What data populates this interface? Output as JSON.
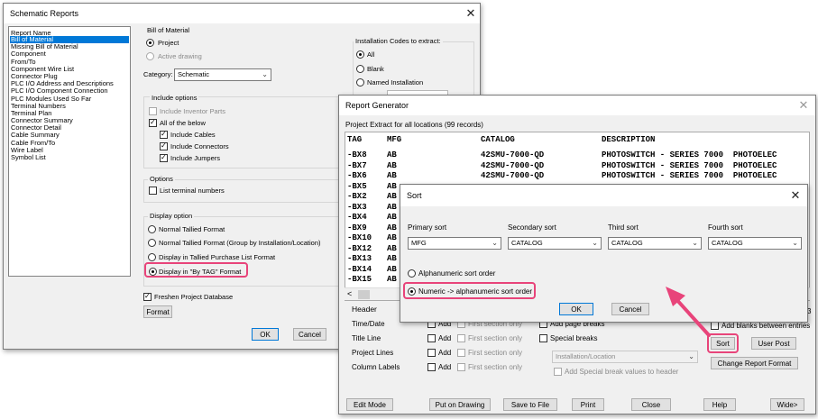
{
  "schematic": {
    "title": "Schematic Reports",
    "report_name_label": "Report Name",
    "reports": [
      "Bill of Material",
      "Missing Bill of Material",
      "Component",
      "From/To",
      "Component Wire List",
      "Connector Plug",
      "PLC I/O Address and Descriptions",
      "PLC I/O Component Connection",
      "PLC Modules Used So Far",
      "Terminal Numbers",
      "Terminal Plan",
      "Connector Summary",
      "Connector Detail",
      "Cable Summary",
      "Cable From/To",
      "Wire Label",
      "Symbol List"
    ],
    "bom_label": "Bill of Material",
    "project": "Project",
    "active_drawing": "Active drawing",
    "category_label": "Category:",
    "category_value": "Schematic",
    "include_options": "Include options",
    "include_inventor": "Include Inventor Parts",
    "all_below": "All of the below",
    "include_cables": "Include Cables",
    "include_connectors": "Include Connectors",
    "include_jumpers": "Include Jumpers",
    "options": "Options",
    "list_terminal": "List terminal numbers",
    "display_option": "Display option",
    "disp1": "Normal Tallied Format",
    "disp2": "Normal Tallied Format (Group by Installation/Location)",
    "disp3": "Display in Tallied Purchase List Format",
    "disp4": "Display in \"By TAG\" Format",
    "freshen": "Freshen Project Database",
    "format_btn": "Format",
    "ok": "OK",
    "cancel": "Cancel",
    "inst_label": "Installation Codes to extract:",
    "inst_all": "All",
    "inst_blank": "Blank",
    "inst_named": "Named Installation"
  },
  "generator": {
    "title": "Report Generator",
    "extract_label": "Project Extract for all locations (99 records)",
    "columns": [
      "TAG",
      "MFG",
      "CATALOG",
      "DESCRIPTION"
    ],
    "rows": [
      {
        "tag": "-BX8",
        "mfg": "AB",
        "catalog": "42SMU-7000-QD",
        "desc": "PHOTOSWITCH - SERIES 7000  PHOTOELEC"
      },
      {
        "tag": "-BX7",
        "mfg": "AB",
        "catalog": "42SMU-7000-QD",
        "desc": "PHOTOSWITCH - SERIES 7000  PHOTOELEC"
      },
      {
        "tag": "-BX6",
        "mfg": "AB",
        "catalog": "42SMU-7000-QD",
        "desc": "PHOTOSWITCH - SERIES 7000  PHOTOELEC"
      },
      {
        "tag": "-BX5",
        "mfg": "AB",
        "catalog": "",
        "desc": ""
      },
      {
        "tag": "-BX2",
        "mfg": "AB",
        "catalog": "",
        "desc": ""
      },
      {
        "tag": "-BX3",
        "mfg": "AB",
        "catalog": "",
        "desc": ""
      },
      {
        "tag": "-BX4",
        "mfg": "AB",
        "catalog": "",
        "desc": ""
      },
      {
        "tag": "-BX9",
        "mfg": "AB",
        "catalog": "",
        "desc": ""
      },
      {
        "tag": "-BX10",
        "mfg": "AB",
        "catalog": "",
        "desc": ""
      },
      {
        "tag": "-BX12",
        "mfg": "AB",
        "catalog": "",
        "desc": ""
      },
      {
        "tag": "-BX13",
        "mfg": "AB",
        "catalog": "",
        "desc": ""
      },
      {
        "tag": "-BX14",
        "mfg": "AB",
        "catalog": "",
        "desc": ""
      },
      {
        "tag": "-BX15",
        "mfg": "AB",
        "catalog": "",
        "desc": ""
      }
    ],
    "header_label": "Header",
    "time_date": "Time/Date",
    "title_line": "Title Line",
    "project_lines": "Project Lines",
    "column_labels": "Column Labels",
    "add": "Add",
    "first_section": "First section only",
    "add_page_breaks": "Add page breaks",
    "special_breaks": "Special breaks",
    "inst_loc": "Installation/Location",
    "add_special": "Add Special break values to header",
    "add_blanks": "Add blanks between entries",
    "page_num": "3",
    "sort_btn": "Sort",
    "user_post": "User Post",
    "change_format": "Change Report Format",
    "edit_mode": "Edit Mode",
    "put_on_drawing": "Put on Drawing",
    "save_to_file": "Save to File",
    "print": "Print",
    "close": "Close",
    "help": "Help",
    "wide": "Wide>"
  },
  "sort": {
    "title": "Sort",
    "primary_label": "Primary sort",
    "primary_value": "MFG",
    "secondary_label": "Secondary sort",
    "secondary_value": "CATALOG",
    "third_label": "Third sort",
    "third_value": "CATALOG",
    "fourth_label": "Fourth sort",
    "fourth_value": "CATALOG",
    "alpha": "Alphanumeric sort order",
    "numeric": "Numeric -> alphanumeric sort order",
    "ok": "OK",
    "cancel": "Cancel"
  },
  "colors": {
    "highlight": "#e8447a",
    "selection": "#0078d7"
  }
}
